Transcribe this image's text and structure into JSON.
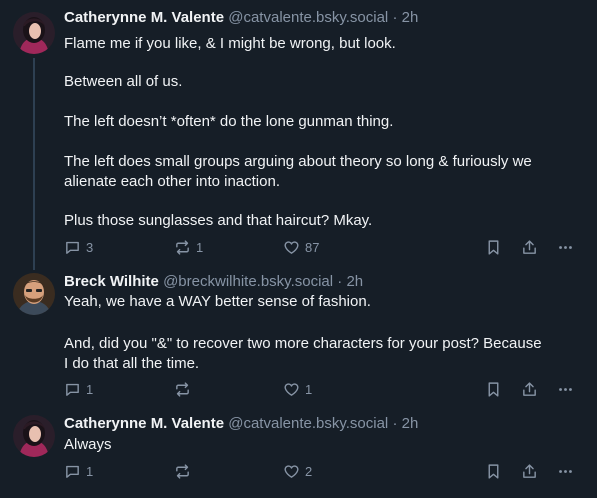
{
  "posts": [
    {
      "author_name": "Catherynne M. Valente",
      "handle": "@catvalente.bsky.social",
      "separator": "·",
      "time": "2h",
      "paragraphs": [
        "Flame me if you like, & I might be wrong, but look.",
        "Between all of us.",
        "The left doesn’t *often* do the lone gunman thing.",
        "The left does small groups arguing about theory so long & furiously we",
        "alienate each other into inaction.",
        "Plus those sunglasses and that haircut? Mkay."
      ],
      "reply_count": "3",
      "repost_count": "1",
      "like_count": "87"
    },
    {
      "author_name": "Breck Wilhite",
      "handle": "@breckwilhite.bsky.social",
      "separator": "·",
      "time": "2h",
      "paragraphs": [
        "Yeah, we have a WAY better sense of fashion.",
        "And, did you \"&\" to recover two more characters for your post? Because",
        "I do that all the time."
      ],
      "reply_count": "1",
      "repost_count": "",
      "like_count": "1"
    },
    {
      "author_name": "Catherynne M. Valente",
      "handle": "@catvalente.bsky.social",
      "separator": "·",
      "time": "2h",
      "paragraphs": [
        "Always"
      ],
      "reply_count": "1",
      "repost_count": "",
      "like_count": "2"
    }
  ],
  "icons": {
    "reply": "reply-bubble-icon",
    "repost": "repost-arrows-icon",
    "like": "heart-icon",
    "bookmark": "bookmark-icon",
    "share": "share-icon",
    "more": "more-options-icon"
  },
  "colors": {
    "background": "#161e27",
    "text": "#f1f3f5",
    "muted": "#8794a5",
    "thread_line": "#2e4052"
  }
}
